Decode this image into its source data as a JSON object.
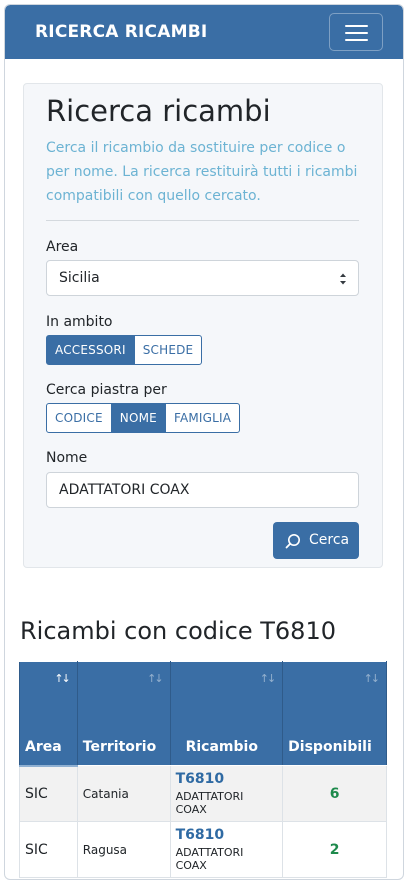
{
  "navbar": {
    "brand": "RICERCA RICAMBI",
    "menu_icon": "hamburger-icon"
  },
  "search": {
    "title": "Ricerca ricambi",
    "description": "Cerca il ricambio da sostituire per codice o per nome. La ricerca restituirà tutti i ricambi compatibili con quello cercato.",
    "area": {
      "label": "Area",
      "value": "Sicilia"
    },
    "ambito": {
      "label": "In ambito",
      "options": [
        "ACCESSORI",
        "SCHEDE"
      ],
      "selected": "ACCESSORI"
    },
    "cerca_per": {
      "label": "Cerca piastra per",
      "options": [
        "CODICE",
        "NOME",
        "FAMIGLIA"
      ],
      "selected": "NOME"
    },
    "nome": {
      "label": "Nome",
      "value": "ADATTATORI COAX"
    },
    "button": {
      "label": "Cerca",
      "icon": "search-icon"
    }
  },
  "results": {
    "title": "Ricambi con codice T6810",
    "columns": [
      "Area",
      "Territorio",
      "Ricambio",
      "Disponibili"
    ],
    "sort_icon": "↑↓",
    "rows": [
      {
        "area": "SIC",
        "territorio": "Catania",
        "codice": "T6810",
        "nome": "ADATTATORI COAX",
        "disponibili": "6"
      },
      {
        "area": "SIC",
        "territorio": "Ragusa",
        "codice": "T6810",
        "nome": "ADATTATORI COAX",
        "disponibili": "2"
      }
    ]
  },
  "colors": {
    "primary": "#3a6ea5",
    "lead_text": "#6cb3d3",
    "available": "#1e8a4c",
    "link": "#2f6aa3"
  }
}
